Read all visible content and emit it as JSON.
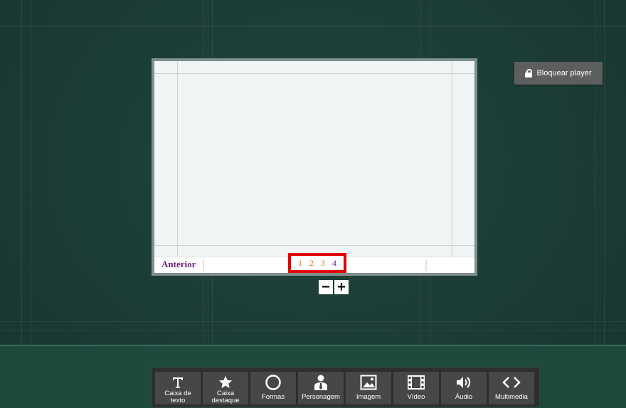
{
  "player": {
    "lock_label": "Bloquear player"
  },
  "slide": {
    "prev_label": "Anterior",
    "pages": [
      "1",
      "2",
      "3",
      "4"
    ],
    "current_page": "4"
  },
  "zoom": {
    "minus_label": "−",
    "plus_label": "+"
  },
  "toolbar": {
    "items": [
      {
        "label": "Caixa de\ntexto",
        "icon": "text-t-icon"
      },
      {
        "label": "Caixa\ndestaque",
        "icon": "star-icon"
      },
      {
        "label": "Formas",
        "icon": "circle-icon"
      },
      {
        "label": "Personagem",
        "icon": "person-icon"
      },
      {
        "label": "Imagem",
        "icon": "image-icon"
      },
      {
        "label": "Vídeo",
        "icon": "film-icon"
      },
      {
        "label": "Áudio",
        "icon": "speaker-icon"
      },
      {
        "label": "Multimedia",
        "icon": "code-brackets-icon"
      }
    ]
  },
  "colors": {
    "background": "#1c3c36",
    "page_current": "#6b1f7f",
    "page_link": "#d97a20",
    "highlight": "#e30000",
    "toolbar": "#2d2f2f"
  }
}
